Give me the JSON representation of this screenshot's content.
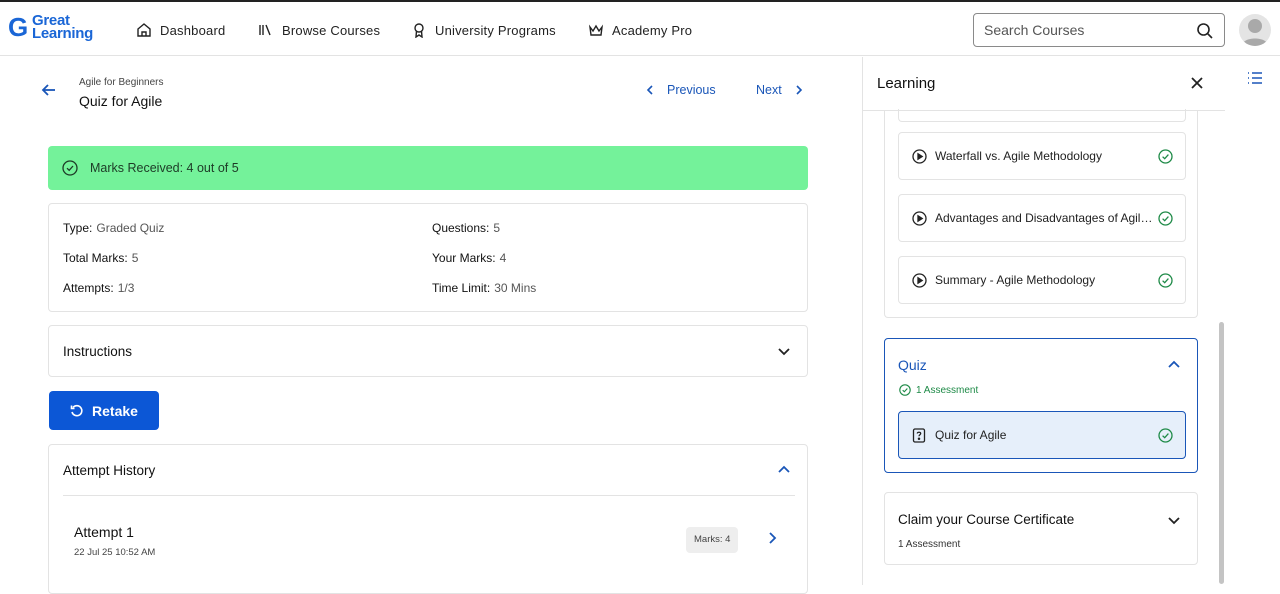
{
  "brand": {
    "logo_line1": "Great",
    "logo_line2": "Learning",
    "logo_mark": "G"
  },
  "nav": {
    "items": [
      {
        "label": "Dashboard",
        "icon": "home-icon"
      },
      {
        "label": "Browse Courses",
        "icon": "library-icon"
      },
      {
        "label": "University Programs",
        "icon": "award-icon"
      },
      {
        "label": "Academy Pro",
        "icon": "crown-icon"
      }
    ]
  },
  "search": {
    "placeholder": "Search Courses"
  },
  "page": {
    "breadcrumb": "Agile for Beginners",
    "title": "Quiz for Agile",
    "prev_label": "Previous",
    "next_label": "Next"
  },
  "result": {
    "banner": "Marks Received: 4 out of 5",
    "color": "#74f29a"
  },
  "details": {
    "type_key": "Type:",
    "type_val": "Graded Quiz",
    "questions_key": "Questions:",
    "questions_val": "5",
    "total_key": "Total Marks:",
    "total_val": "5",
    "your_key": "Your Marks:",
    "your_val": "4",
    "attempts_key": "Attempts:",
    "attempts_val": "1/3",
    "time_key": "Time Limit:",
    "time_val": "30 Mins"
  },
  "instructions": {
    "label": "Instructions"
  },
  "retake": {
    "label": "Retake",
    "color": "#0c57d6"
  },
  "history": {
    "title": "Attempt History",
    "attempts": [
      {
        "name": "Attempt 1",
        "date": "22 Jul 25 10:52 AM",
        "marks": "Marks: 4"
      }
    ]
  },
  "sidebar": {
    "title": "Learning",
    "lessons": [
      {
        "label": "Waterfall vs. Agile Methodology"
      },
      {
        "label": "Advantages and Disadvantages of Agile Methodology"
      },
      {
        "label": "Summary - Agile Methodology"
      }
    ],
    "quiz_module": {
      "title": "Quiz",
      "subtitle": "1 Assessment",
      "item": "Quiz for Agile"
    },
    "certificate": {
      "title": "Claim your Course Certificate",
      "subtitle": "1 Assessment"
    }
  },
  "colors": {
    "accent": "#1a56b8",
    "success": "#1e8a47"
  }
}
